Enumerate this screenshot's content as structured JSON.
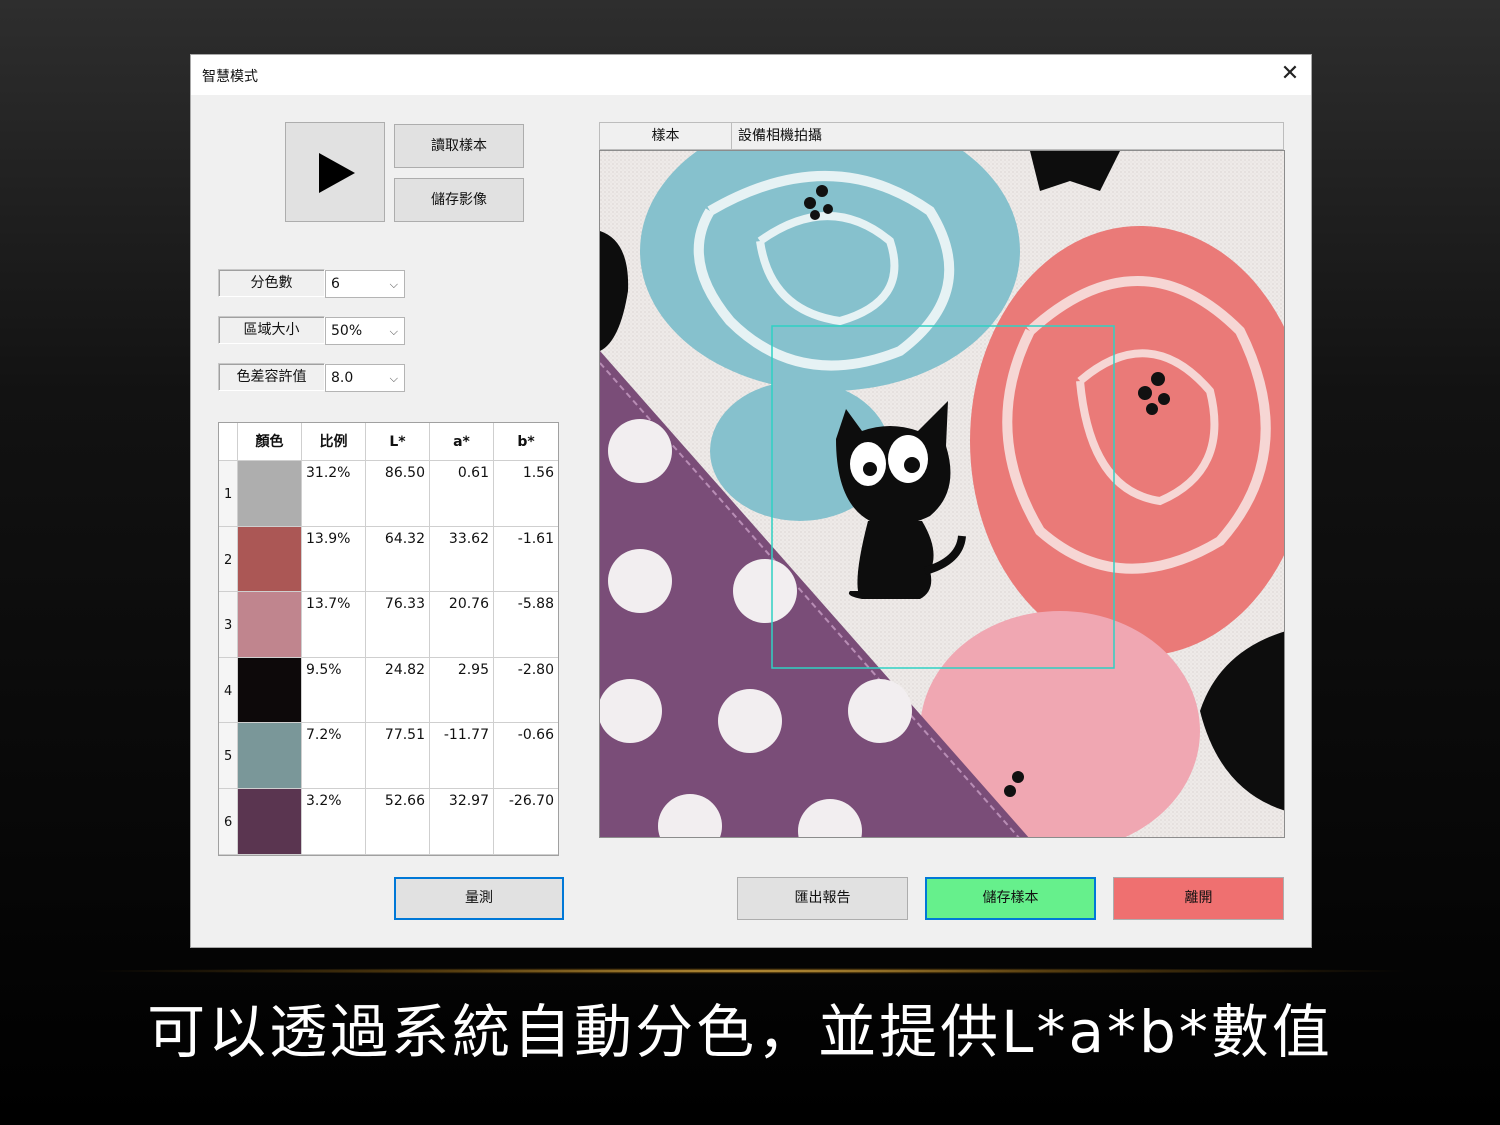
{
  "window": {
    "title": "智慧模式",
    "close": "✕"
  },
  "buttons": {
    "load_sample": "讀取樣本",
    "save_image": "儲存影像",
    "measure": "量測",
    "export_report": "匯出報告",
    "save_sample": "儲存樣本",
    "exit": "離開"
  },
  "params": {
    "color_count": {
      "label": "分色數",
      "value": "6"
    },
    "region_size": {
      "label": "區域大小",
      "value": "50%"
    },
    "tolerance": {
      "label": "色差容許值",
      "value": "8.0"
    }
  },
  "table": {
    "headers": [
      "顏色",
      "比例",
      "L*",
      "a*",
      "b*"
    ],
    "rows": [
      {
        "index": "1",
        "color": "#aeaeae",
        "ratio": "31.2%",
        "L": "86.50",
        "a": "0.61",
        "b": "1.56"
      },
      {
        "index": "2",
        "color": "#ab5755",
        "ratio": "13.9%",
        "L": "64.32",
        "a": "33.62",
        "b": "-1.61"
      },
      {
        "index": "3",
        "color": "#c0858e",
        "ratio": "13.7%",
        "L": "76.33",
        "a": "20.76",
        "b": "-5.88"
      },
      {
        "index": "4",
        "color": "#0d090a",
        "ratio": "9.5%",
        "L": "24.82",
        "a": "2.95",
        "b": "-2.80"
      },
      {
        "index": "5",
        "color": "#7a9799",
        "ratio": "7.2%",
        "L": "77.51",
        "a": "-11.77",
        "b": "-0.66"
      },
      {
        "index": "6",
        "color": "#5a3550",
        "ratio": "3.2%",
        "L": "52.66",
        "a": "32.97",
        "b": "-26.70"
      }
    ]
  },
  "tabs": {
    "sample": "樣本",
    "camera": "設備相機拍攝"
  },
  "caption": "可以透過系統自動分色，並提供L*a*b*數值",
  "colors": {
    "accent_blue": "#0078d7",
    "save_sample_green": "#66f08c",
    "exit_red": "#ef7070",
    "roi_box": "#2fd1c3"
  }
}
